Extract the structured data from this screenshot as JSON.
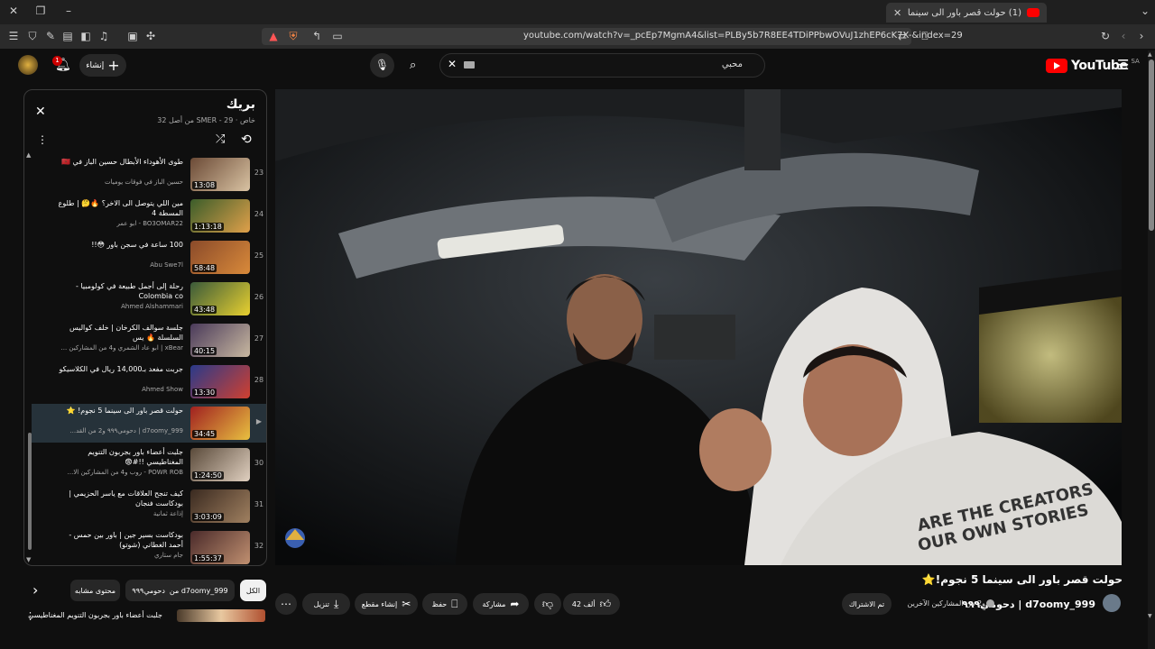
{
  "browser": {
    "tab_title": "(1) حولت قصر باور الى سينما 5",
    "url": "youtube.com/watch?v=_pcEp7MgmA4&list=PLBy5b7R8EE4TDiPPbwOVuJ1zhEP6cK7X-&index=29"
  },
  "youtube": {
    "logo": "YouTube",
    "country": "SA",
    "search_value": "محبي",
    "notification_count": "1",
    "create_label": "إنشاء"
  },
  "playlist": {
    "title": "بريك",
    "subtitle": "خاص · SMER - 29 من أصل 32",
    "items": [
      {
        "num": "23",
        "title": "طوى الأهوداء الأبطال حسين الباز في 🇲🇦",
        "channel": "حسين الباز في فوقات يوميات",
        "duration": "13:08",
        "c1": "#6b4a36",
        "c2": "#d9c3a3"
      },
      {
        "num": "24",
        "title": "مين اللي يتوصل الى الاخر؟ 🔥🤔 | طلوع المسطة 4",
        "channel": "BO3OMAR22 - ابو عمر",
        "duration": "1:13:18",
        "c1": "#3b5d2a",
        "c2": "#e0a04a"
      },
      {
        "num": "25",
        "title": "100 ساعة في سجن باور 😳!!",
        "channel": "Abu Swe7l",
        "duration": "58:48",
        "c1": "#8a4a2a",
        "c2": "#d98a3a"
      },
      {
        "num": "26",
        "title": "رحلة إلى أجمل طبيعة في كولومبيا - Colombia co",
        "channel": "Ahmed Alshammari",
        "duration": "43:48",
        "c1": "#3a5a3a",
        "c2": "#e8d030"
      },
      {
        "num": "27",
        "title": "جلسة سوالف الكرخان | خلف كواليس السلسلة 🔥 يس",
        "channel": "xBear | ابو عاد الشمري و4 من المشاركين ...",
        "duration": "40:15",
        "c1": "#4a3a5a",
        "c2": "#c8b8a0"
      },
      {
        "num": "28",
        "title": "جربت مفعد بـ14,000 ريال في الكلاسيكو",
        "channel": "Ahmed Show",
        "duration": "13:30",
        "c1": "#2a3a8a",
        "c2": "#d04030"
      },
      {
        "num": "",
        "title": "حولت قصر باور الى سينما 5 نجوم! ⭐",
        "channel": "d7oomy_999 | دحومي٩٩٩ و2 من القد...",
        "duration": "34:45",
        "c1": "#a02020",
        "c2": "#e8c040",
        "active": true
      },
      {
        "num": "30",
        "title": "جلبت أعضاء باور بجربون التنويم المغناطيسي !!#😨",
        "channel": "POWR ROB - روب و4 من المشاركين الا...",
        "duration": "1:24:50",
        "c1": "#5a4a3a",
        "c2": "#e0d0c0"
      },
      {
        "num": "31",
        "title": "كيف تنجح العلاقات مع ياسر الحزيمي | بودكاست فنجان",
        "channel": "إذاعة ثمانية",
        "duration": "3:03:09",
        "c1": "#3a2a20",
        "c2": "#a08060"
      },
      {
        "num": "32",
        "title": "بودكاست بسير جين | باور بين حمس - أحمد الغطاني (شوتو)",
        "channel": "جام ستاري",
        "duration": "1:55:37",
        "c1": "#4a2a2a",
        "c2": "#c09070"
      }
    ]
  },
  "video": {
    "title": "حولت قصر باور الى سينما 5 نجوم!⭐",
    "channel": "d7oomy_999 | دحومي٩٩٩",
    "collab": "و2 من المشاركين الآخرين",
    "subscribed": "تم الاشتراك",
    "likes": "42 ألف",
    "share": "مشاركة",
    "save": "حفظ",
    "clip": "إنشاء مقطع",
    "download": "تنزيل",
    "hoodie_text_1": "ARE THE CREATORS",
    "hoodie_text_2": "OUR OWN STORIES"
  },
  "chips": {
    "all": "الكل",
    "from": "من d7oomy_999",
    "channel": "دحومي٩٩٩",
    "related": "محتوى مشابه"
  },
  "next": {
    "title": "جلبت أعضاء باور بجربون التنويم المغناطيسي"
  }
}
